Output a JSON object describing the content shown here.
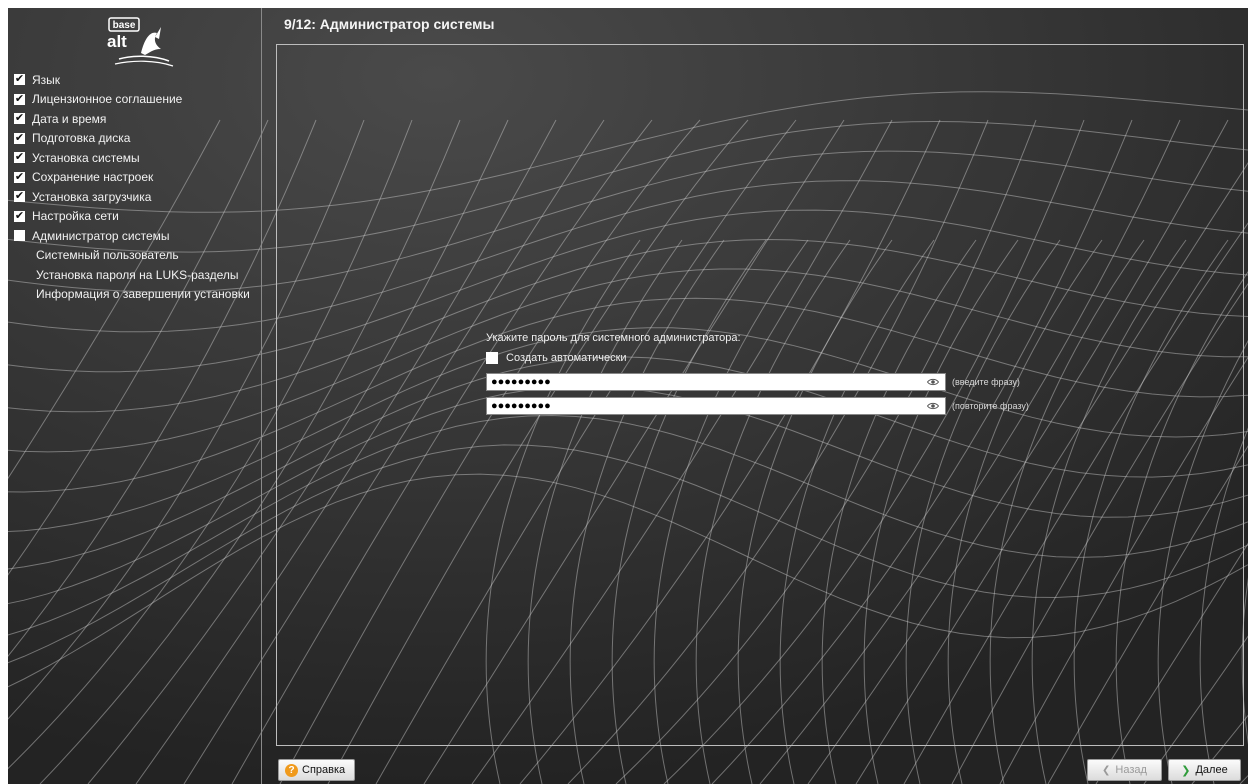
{
  "header": {
    "title": "9/12: Администратор системы"
  },
  "logo": {
    "line1": "base",
    "line2": "alt"
  },
  "sidebar": {
    "steps": [
      {
        "label": "Язык",
        "checked": true
      },
      {
        "label": "Лицензионное соглашение",
        "checked": true
      },
      {
        "label": "Дата и время",
        "checked": true
      },
      {
        "label": "Подготовка диска",
        "checked": true
      },
      {
        "label": "Установка системы",
        "checked": true
      },
      {
        "label": "Сохранение настроек",
        "checked": true
      },
      {
        "label": "Установка загрузчика",
        "checked": true
      },
      {
        "label": "Настройка сети",
        "checked": true
      },
      {
        "label": "Администратор системы",
        "checked": false,
        "current": true
      },
      {
        "label": "Системный пользователь"
      },
      {
        "label": "Установка пароля на LUKS-разделы"
      },
      {
        "label": "Информация о завершении установки"
      }
    ]
  },
  "form": {
    "prompt": "Укажите пароль для системного администратора:",
    "auto_label": "Создать автоматически",
    "auto_checked": false,
    "password": {
      "value": "●●●●●●●●●",
      "hint": "(введите фразу)"
    },
    "confirm": {
      "value": "●●●●●●●●●",
      "hint": "(повторите фразу)"
    }
  },
  "buttons": {
    "help": "Справка",
    "back": "Назад",
    "next": "Далее"
  },
  "icons": {
    "check": "✔",
    "help": "?",
    "back_arrow": "❮",
    "next_arrow": "❯"
  },
  "colors": {
    "background": "#2f2f2f",
    "help_icon": "#f09a1c",
    "next_arrow": "#2e9b3a"
  }
}
